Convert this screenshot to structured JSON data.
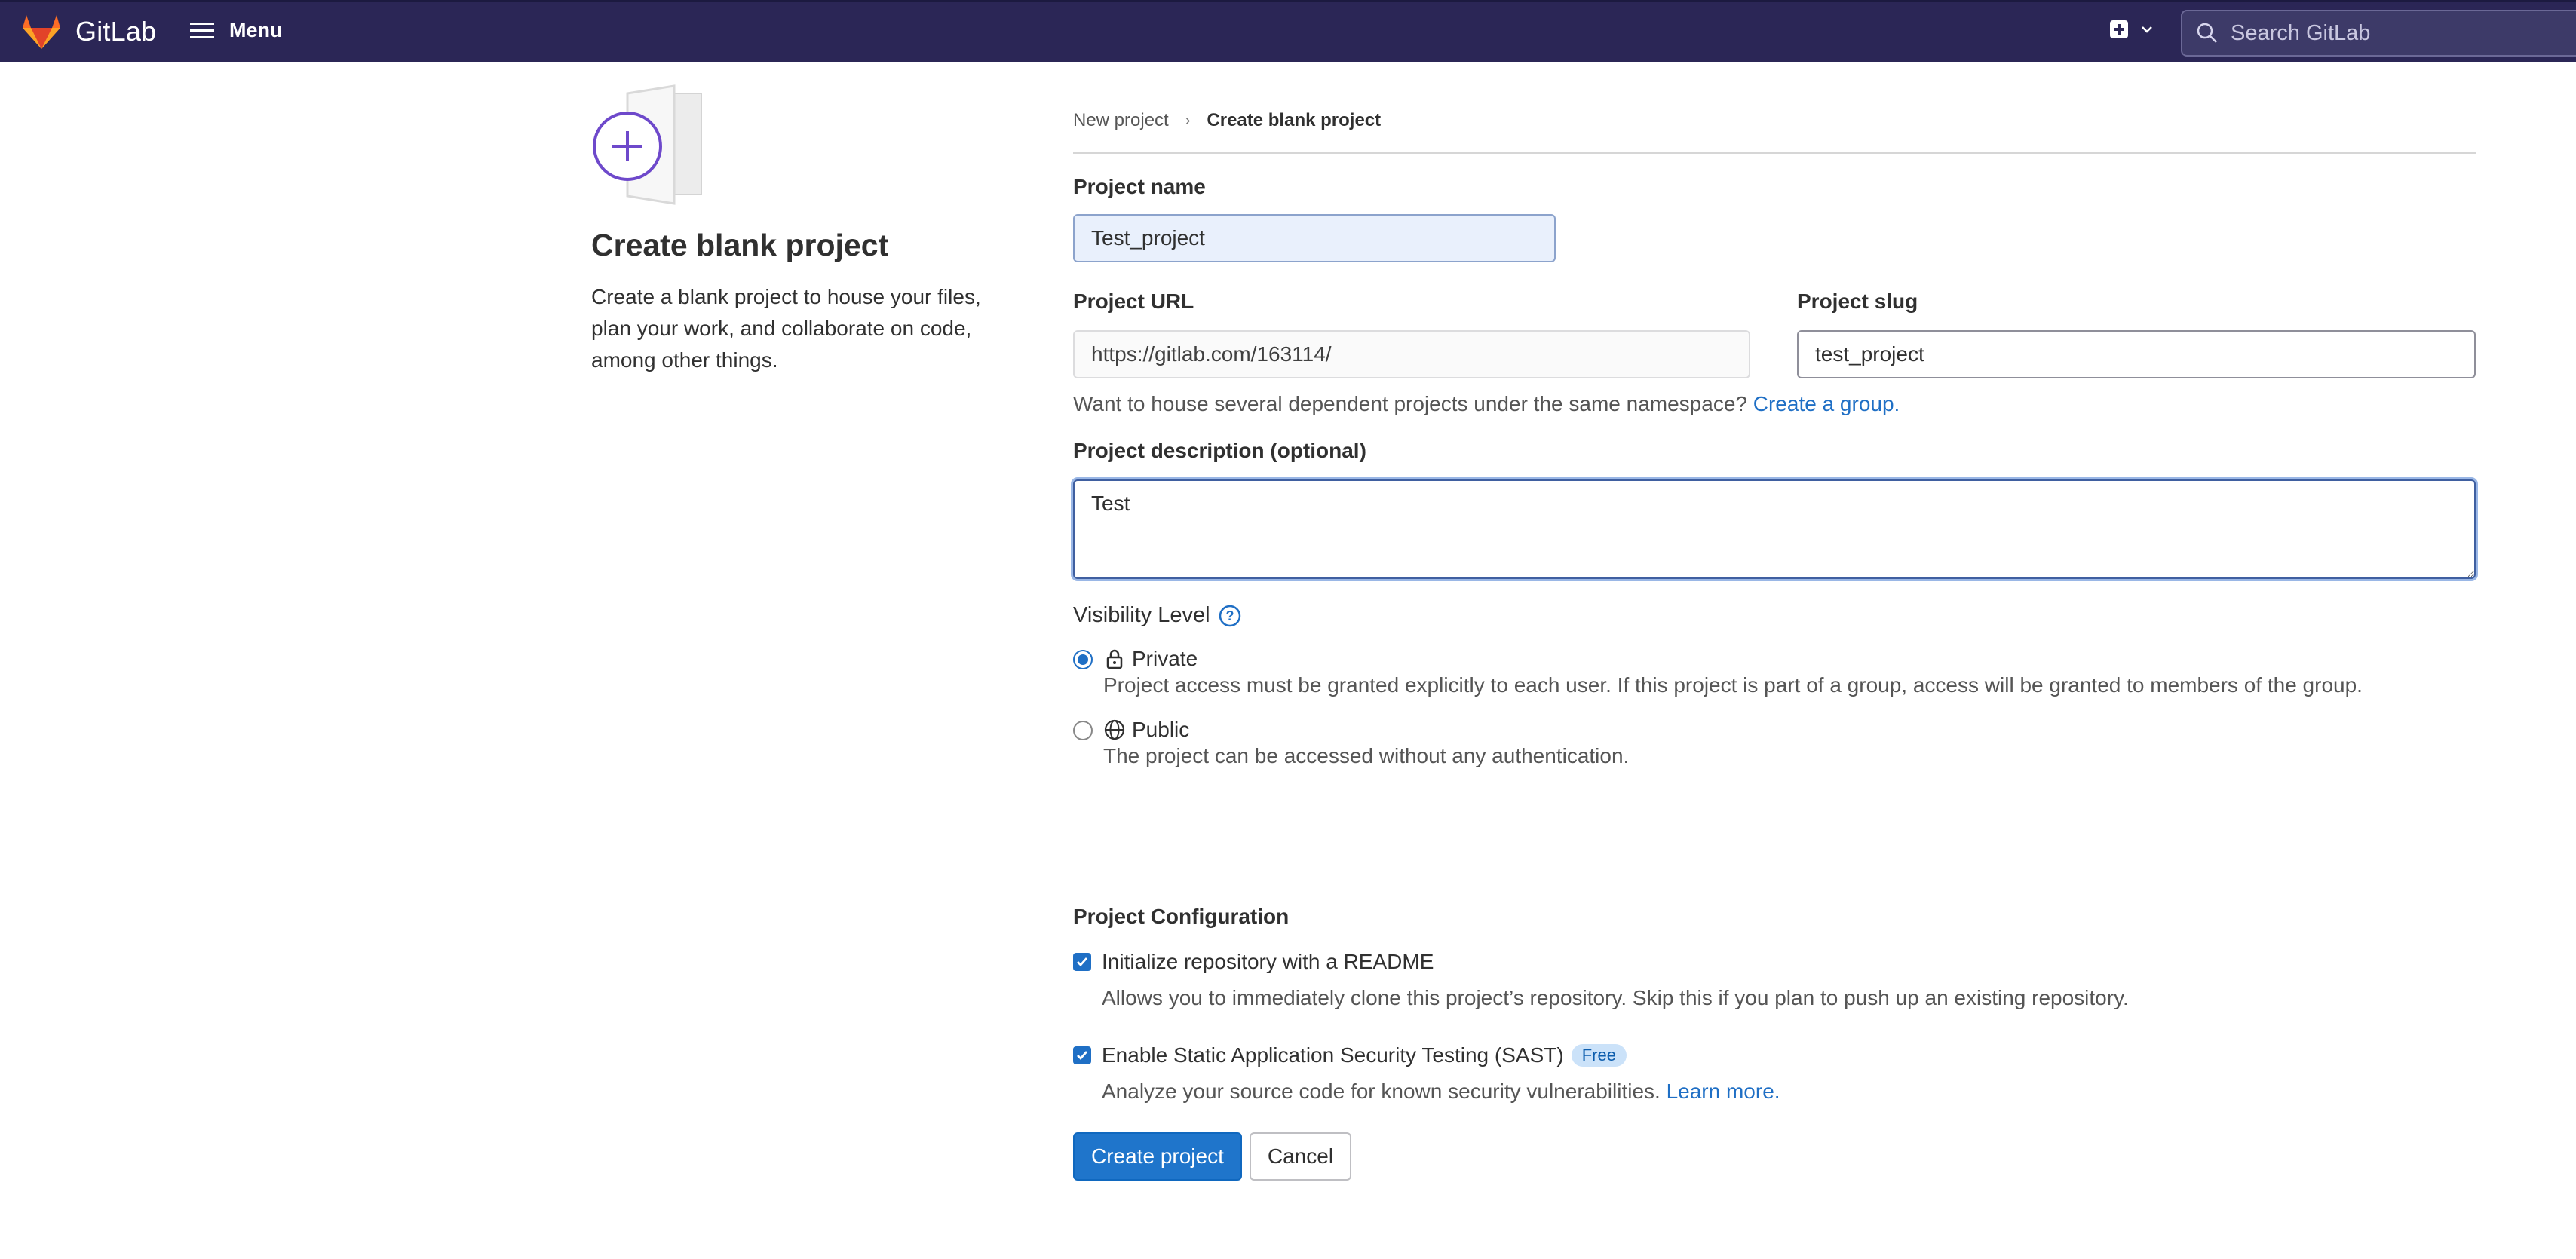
{
  "navbar": {
    "brand": "GitLab",
    "menu_label": "Menu",
    "search_placeholder": "Search GitLab",
    "colors": {
      "background": "#2b2656",
      "logo_orange": "#e24329"
    }
  },
  "intro": {
    "title": "Create blank project",
    "description": "Create a blank project to house your files, plan your work, and collaborate on code, among other things."
  },
  "breadcrumb": {
    "parent": "New project",
    "current": "Create blank project"
  },
  "form": {
    "project_name_label": "Project name",
    "project_name_value": "Test_project",
    "project_url_label": "Project URL",
    "project_url_value": "https://gitlab.com/163114/",
    "project_slug_label": "Project slug",
    "project_slug_value": "test_project",
    "namespace_hint": "Want to house several dependent projects under the same namespace?",
    "create_group_link": "Create a group.",
    "description_label": "Project description (optional)",
    "description_value": "Test",
    "visibility_label": "Visibility Level",
    "visibility_options": [
      {
        "label": "Private",
        "icon": "lock-icon",
        "description": "Project access must be granted explicitly to each user. If this project is part of a group, access will be granted to members of the group.",
        "selected": true
      },
      {
        "label": "Public",
        "icon": "globe-icon",
        "description": "The project can be accessed without any authentication.",
        "selected": false
      }
    ],
    "config_label": "Project Configuration",
    "readme": {
      "label": "Initialize repository with a README",
      "description": "Allows you to immediately clone this project’s repository. Skip this if you plan to push up an existing repository.",
      "checked": true
    },
    "sast": {
      "label": "Enable Static Application Security Testing (SAST)",
      "badge": "Free",
      "description": "Analyze your source code for known security vulnerabilities.",
      "learn_more": "Learn more.",
      "checked": true
    },
    "create_button": "Create project",
    "cancel_button": "Cancel"
  }
}
